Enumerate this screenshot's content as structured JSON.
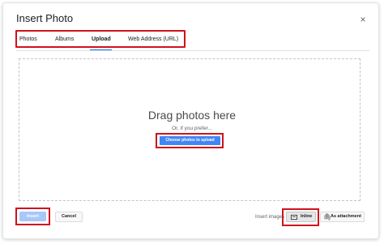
{
  "dialog": {
    "title": "Insert Photo",
    "close_icon": "close-icon",
    "close_glyph": "×"
  },
  "tabs": [
    {
      "label": "Photos",
      "active": false
    },
    {
      "label": "Albums",
      "active": false
    },
    {
      "label": "Upload",
      "active": true
    },
    {
      "label": "Web Address (URL)",
      "active": false
    }
  ],
  "upload": {
    "drag_text": "Drag photos here",
    "prefer_text": "Or, if you prefer...",
    "choose_button": "Choose photos to upload"
  },
  "footer": {
    "insert_button": "Insert",
    "cancel_button": "Cancel",
    "insert_images_label": "Insert images",
    "inline_button": "Inline",
    "inline_icon": "image-inline-icon",
    "attachment_button": "As attachment",
    "attachment_icon": "paperclip-icon",
    "attachment_glyph": "🖇"
  },
  "colors": {
    "accent": "#1a73e8",
    "primary_button": "#4285f4",
    "disabled_primary": "#a8c7fa",
    "highlight_outline": "#d0121d"
  }
}
